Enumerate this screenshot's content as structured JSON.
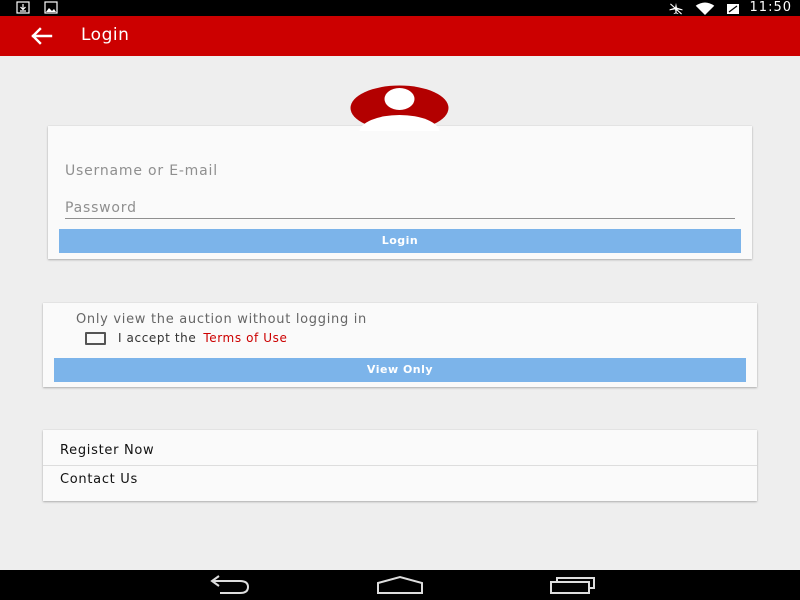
{
  "status_bar": {
    "time": "11:50",
    "left_icons": [
      "download-icon",
      "image-icon"
    ],
    "right_icons": [
      "airplane-mode-icon",
      "wifi-icon",
      "battery-icon"
    ]
  },
  "app_bar": {
    "title": "Login",
    "back_icon": "back-arrow-icon",
    "background": "#cc0000"
  },
  "avatar": {
    "icon": "user-avatar-icon",
    "color": "#b30000"
  },
  "login_card": {
    "username_placeholder": "Username or E-mail",
    "password_placeholder": "Password",
    "login_button": "Login"
  },
  "view_only_card": {
    "heading": "Only view the auction without logging in",
    "accept_text": "I accept the",
    "terms_link": "Terms of Use",
    "checkbox_checked": false,
    "view_only_button": "View Only"
  },
  "links_card": {
    "register": "Register Now",
    "contact": "Contact Us"
  },
  "nav_bar": {
    "buttons": [
      "back-nav-icon",
      "home-nav-icon",
      "recents-nav-icon"
    ]
  },
  "colors": {
    "accent": "#cc0000",
    "button": "#7cb4ea",
    "background": "#eeeeee"
  }
}
